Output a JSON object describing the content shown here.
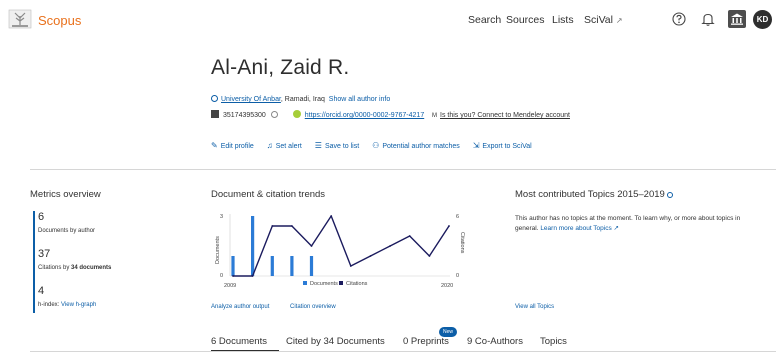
{
  "header": {
    "brand": "Scopus",
    "nav": [
      "Search",
      "Sources",
      "Lists"
    ],
    "scival": "SciVal",
    "scival_ext": "↗",
    "avatar_initials": "KD"
  },
  "author": {
    "name": "Al-Ani, Zaid R.",
    "university": "University Of Anbar",
    "location": ", Ramadi, Iraq",
    "show_all": "Show all author info",
    "author_id": "35174395300",
    "orcid": "https://orcid.org/0000-0002-9767-4217",
    "mendeley_prefix": "Is this you? Connect to Mendeley account",
    "actions": [
      "Edit profile",
      "Set alert",
      "Save to list",
      "Potential author matches",
      "Export to SciVal"
    ]
  },
  "metrics": {
    "title": "Metrics overview",
    "documents": "6",
    "documents_label": "Documents by author",
    "citations": "37",
    "citations_label_pre": "Citations by ",
    "citations_label_bold": "34 documents",
    "h_index": "4",
    "h_index_label": "h-index:",
    "h_graph": "View h-graph"
  },
  "trends": {
    "title": "Document & citation trends",
    "analyze_link": "Analyze author output",
    "citation_overview_link": "Citation overview"
  },
  "chart_data": {
    "type": "bar",
    "x_start_label": "2009",
    "x_end_label": "2020",
    "left_axis_label": "Documents",
    "right_axis_label": "Citations",
    "left_ticks": [
      "0",
      "3"
    ],
    "right_ticks": [
      "0",
      "6"
    ],
    "left_ylim": [
      0,
      3
    ],
    "right_ylim": [
      0,
      6
    ],
    "legend": [
      "Documents",
      "Citations"
    ],
    "documents": [
      1,
      3,
      1,
      1,
      1,
      0,
      0,
      0,
      0,
      0,
      0,
      0
    ],
    "citations": [
      0,
      0,
      5,
      5,
      3,
      6,
      1,
      2,
      3,
      4,
      2,
      5
    ],
    "colors": {
      "documents": "#2b7bd6",
      "citations": "#1b1b5e"
    }
  },
  "topics": {
    "title": "Most contributed Topics 2015–2019",
    "text": "This author has no topics at the moment. To learn why, or more about topics in general.",
    "learn_more": "Learn more about Topics ↗",
    "view_all": "View all Topics"
  },
  "tabs": [
    "6 Documents",
    "Cited by 34 Documents",
    "0 Preprints",
    "9 Co-Authors",
    "Topics"
  ],
  "new_badge": "New"
}
